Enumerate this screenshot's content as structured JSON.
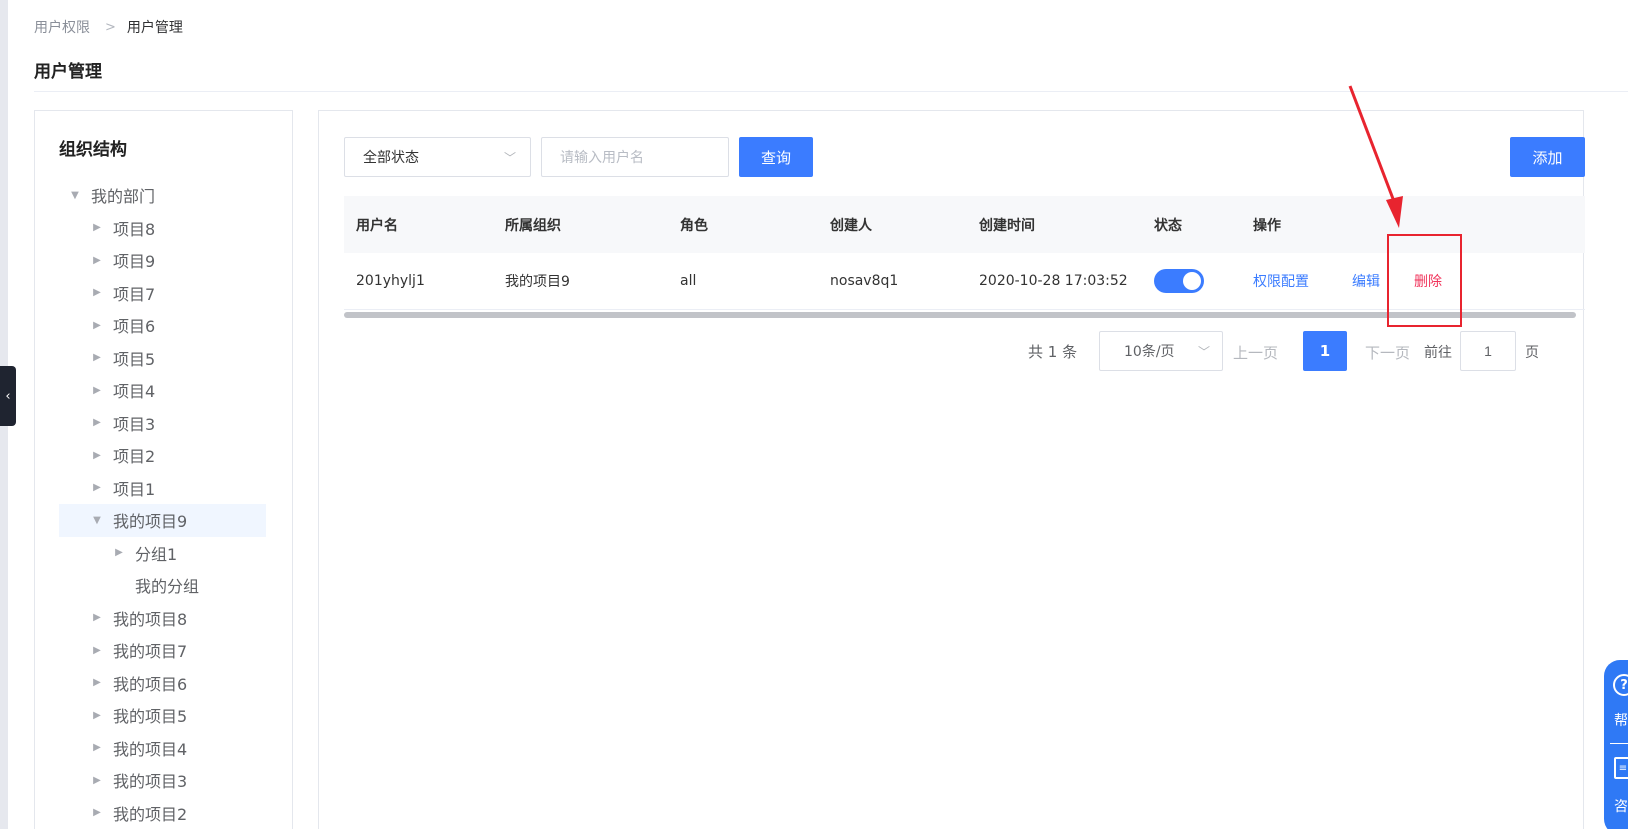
{
  "breadcrumb": {
    "parent": "用户权限",
    "separator": ">",
    "current": "用户管理"
  },
  "page": {
    "title": "用户管理"
  },
  "tree": {
    "title": "组织结构",
    "nodes": [
      {
        "label": "我的部门",
        "level": 0,
        "state": "expanded"
      },
      {
        "label": "项目8",
        "level": 1,
        "state": "collapsed"
      },
      {
        "label": "项目9",
        "level": 1,
        "state": "collapsed"
      },
      {
        "label": "项目7",
        "level": 1,
        "state": "collapsed"
      },
      {
        "label": "项目6",
        "level": 1,
        "state": "collapsed"
      },
      {
        "label": "项目5",
        "level": 1,
        "state": "collapsed"
      },
      {
        "label": "项目4",
        "level": 1,
        "state": "collapsed"
      },
      {
        "label": "项目3",
        "level": 1,
        "state": "collapsed"
      },
      {
        "label": "项目2",
        "level": 1,
        "state": "collapsed"
      },
      {
        "label": "项目1",
        "level": 1,
        "state": "collapsed"
      },
      {
        "label": "我的项目9",
        "level": 1,
        "state": "expanded",
        "active": true
      },
      {
        "label": "分组1",
        "level": 2,
        "state": "collapsed"
      },
      {
        "label": "我的分组",
        "level": 2,
        "state": "leaf"
      },
      {
        "label": "我的项目8",
        "level": 1,
        "state": "collapsed"
      },
      {
        "label": "我的项目7",
        "level": 1,
        "state": "collapsed"
      },
      {
        "label": "我的项目6",
        "level": 1,
        "state": "collapsed"
      },
      {
        "label": "我的项目5",
        "level": 1,
        "state": "collapsed"
      },
      {
        "label": "我的项目4",
        "level": 1,
        "state": "collapsed"
      },
      {
        "label": "我的项目3",
        "level": 1,
        "state": "collapsed"
      },
      {
        "label": "我的项目2",
        "level": 1,
        "state": "collapsed"
      }
    ]
  },
  "filters": {
    "status_select": "全部状态",
    "username_placeholder": "请输入用户名",
    "query_label": "查询",
    "add_label": "添加"
  },
  "table": {
    "headers": [
      "用户名",
      "所属组织",
      "角色",
      "创建人",
      "创建时间",
      "状态",
      "操作"
    ],
    "rows": [
      {
        "username": "201yhylj1",
        "org": "我的项目9",
        "role": "all",
        "creator": "nosav8q1",
        "created": "2020-10-28 17:03:52",
        "status_on": true,
        "actions": [
          "权限配置",
          "编辑",
          "删除"
        ]
      }
    ]
  },
  "pagination": {
    "total": "共 1 条",
    "page_size": "10条/页",
    "prev": "上一页",
    "current": "1",
    "next": "下一页",
    "goto": "前往",
    "goto_value": "1",
    "page_suffix": "页"
  },
  "help_widget": {
    "help_text": "帮",
    "consult_text": "咨"
  },
  "colors": {
    "primary": "#3b7cff",
    "danger": "#f0335a",
    "annotation": "#e8242f"
  }
}
